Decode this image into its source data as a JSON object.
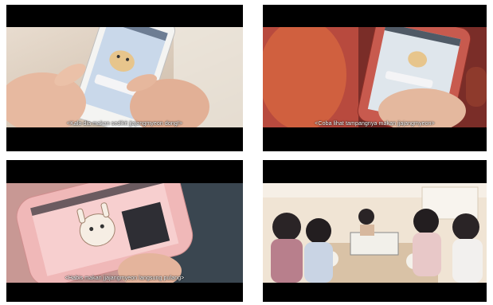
{
  "panels": [
    {
      "id": 1,
      "subtitle": "<Kalo dia makan sedikit jjajangmyeon dong!>",
      "colors": {
        "bg": "#d9c8b8",
        "phone": "#c8d4e6"
      }
    },
    {
      "id": 2,
      "subtitle": "<Coba lihat tampangnya makan jjajangmyeon>",
      "colors": {
        "bg": "#b6443a",
        "case": "#c85a4e"
      }
    },
    {
      "id": 3,
      "subtitle": "<Habis makan jjajangmyeon langsung pulang>",
      "colors": {
        "bg": "#d8a6a4",
        "case": "#f0b8b8"
      }
    },
    {
      "id": 4,
      "subtitle": "",
      "colors": {
        "bg": "#e8d8c6",
        "wall": "#f0e4d4"
      }
    }
  ]
}
